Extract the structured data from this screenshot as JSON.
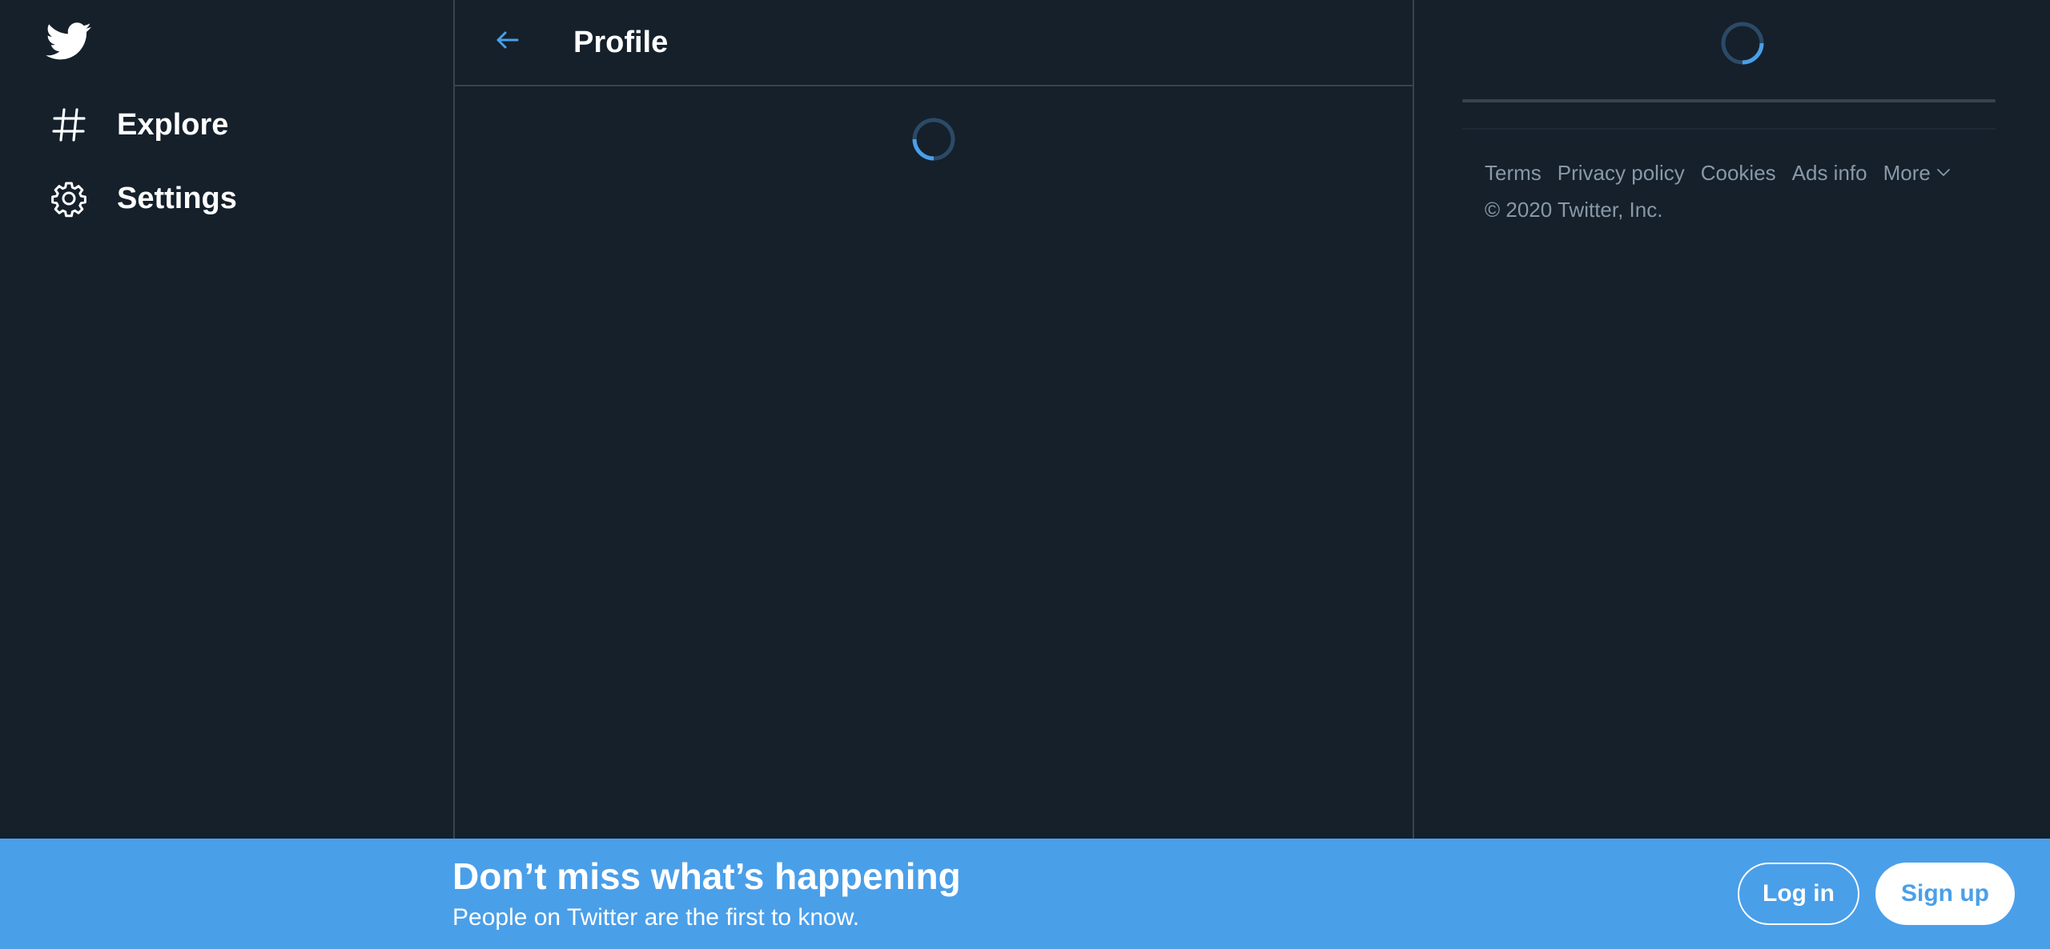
{
  "colors": {
    "background": "#15202b",
    "border": "#38444d",
    "accent": "#4a9fe9",
    "muted_text": "#8899a6",
    "text": "#ffffff"
  },
  "sidebar": {
    "logo_icon": "twitter-bird-icon",
    "items": [
      {
        "label": "Explore",
        "icon": "hashtag-icon"
      },
      {
        "label": "Settings",
        "icon": "gear-icon"
      }
    ]
  },
  "main": {
    "back_icon": "arrow-left-icon",
    "title": "Profile",
    "loading_icon": "spinner-icon"
  },
  "right": {
    "loading_icon": "spinner-icon",
    "footer_links": [
      "Terms",
      "Privacy policy",
      "Cookies",
      "Ads info"
    ],
    "more_label": "More",
    "copyright": "© 2020 Twitter, Inc."
  },
  "banner": {
    "headline": "Don’t miss what’s happening",
    "subtext": "People on Twitter are the first to know.",
    "login_label": "Log in",
    "signup_label": "Sign up"
  }
}
